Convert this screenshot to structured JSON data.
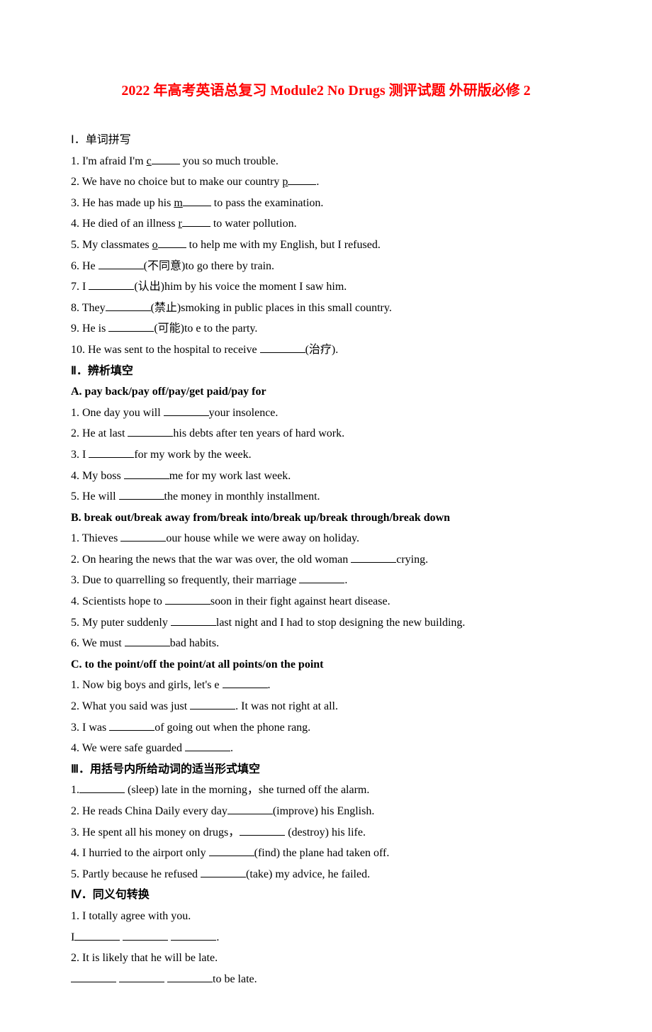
{
  "title": "2022 年高考英语总复习 Module2 No Drugs 测评试题 外研版必修 2",
  "s1": {
    "head": "Ⅰ．单词拼写",
    "q1a": "1. I'm afraid I'm ",
    "q1u": "c",
    "q1b": " you so much trouble.",
    "q2a": "2. We have no choice but to make our country ",
    "q2u": "p",
    "q2b": ".",
    "q3a": "3. He has made up his ",
    "q3u": "m",
    "q3b": " to pass the examination.",
    "q4a": "4. He died of an illness ",
    "q4u": "r",
    "q4b": " to water pollution.",
    "q5a": "5. My classmates ",
    "q5u": "o",
    "q5b": " to help me with my English, but I refused.",
    "q6a": "6. He ",
    "q6b": "(不同意)to go there by train.",
    "q7a": "7. I ",
    "q7b": "(认出)him by his voice the moment I saw him.",
    "q8a": "8. They",
    "q8b": "(禁止)smoking in public places in this small country.",
    "q9a": "9. He is ",
    "q9b": "(可能)to e to the party.",
    "q10a": "10. He was sent to the hospital to receive ",
    "q10b": "(治疗)."
  },
  "s2": {
    "head": "Ⅱ．辨析填空",
    "A": {
      "head": "A. pay back/pay off/pay/get paid/pay for",
      "q1a": "1. One day you will ",
      "q1b": "your insolence.",
      "q2a": "2. He at last ",
      "q2b": "his debts after ten years of hard work.",
      "q3a": "3. I ",
      "q3b": "for my work by the week.",
      "q4a": "4. My boss ",
      "q4b": "me for my work last week.",
      "q5a": "5. He will ",
      "q5b": "the money in monthly installment."
    },
    "B": {
      "head": "B. break out/break away from/break into/break up/break through/break down",
      "q1a": "1. Thieves ",
      "q1b": "our house while we were away on holiday.",
      "q2a": "2. On hearing the news that the war was over, the old woman ",
      "q2b": "crying.",
      "q3a": "3. Due to quarrelling so frequently, their marriage ",
      "q3b": ".",
      "q4a": "4. Scientists hope to ",
      "q4b": "soon in their fight against heart disease.",
      "q5a": "5. My puter suddenly ",
      "q5b": "last night and I had to stop designing the new building.",
      "q6a": "6. We must ",
      "q6b": "bad habits."
    },
    "C": {
      "head": "C. to the point/off the point/at all points/on the point",
      "q1a": "1. Now big boys and girls, let's e ",
      "q1b": ".",
      "q2a": "2. What you said was just ",
      "q2b": ". It was not right at all.",
      "q3a": "3. I was ",
      "q3b": "of going out when the phone rang.",
      "q4a": "4. We were safe guarded ",
      "q4b": "."
    }
  },
  "s3": {
    "head": "Ⅲ．用括号内所给动词的适当形式填空",
    "q1a": "1.",
    "q1b": " (sleep) late in the morning，she turned off the alarm.",
    "q2a": "2. He reads China Daily every day",
    "q2b": "(improve) his English.",
    "q3a": "3. He spent all his money on drugs，",
    "q3b": " (destroy) his life.",
    "q4a": "4. I hurried to the airport only ",
    "q4b": "(find) the plane had taken off.",
    "q5a": "5. Partly because he refused ",
    "q5b": "(take) my advice, he failed."
  },
  "s4": {
    "head": "Ⅳ．同义句转换",
    "q1": "1. I totally agree with you.",
    "q1ans_a": "I",
    "q1ans_b": ".",
    "q2": "2. It is likely that he will be late.",
    "q2ans_b": "to be late."
  }
}
